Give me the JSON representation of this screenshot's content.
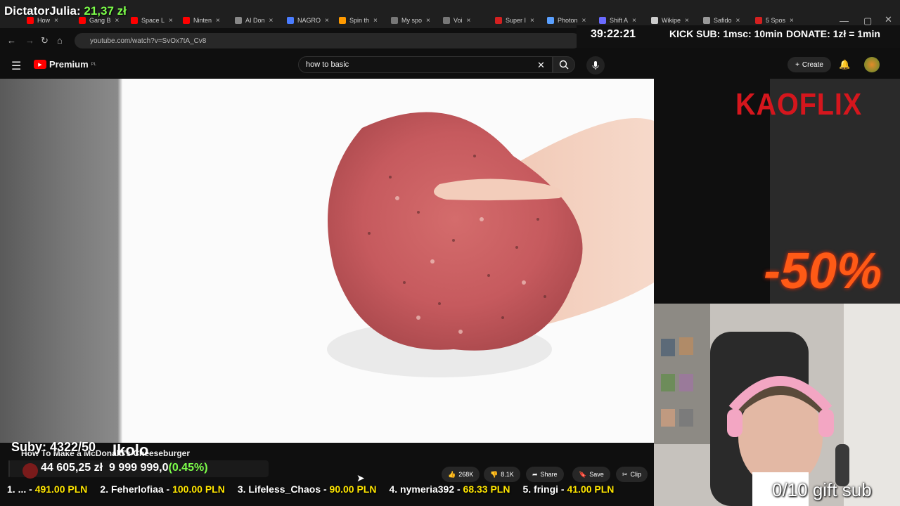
{
  "browser": {
    "tabs": [
      {
        "label": "How",
        "color": "#ff0000"
      },
      {
        "label": "Gang B",
        "color": "#ff0000"
      },
      {
        "label": "Space L",
        "color": "#ff0000"
      },
      {
        "label": "Ninten",
        "color": "#ff0000"
      },
      {
        "label": "AI Don",
        "color": "#888888"
      },
      {
        "label": "NAGRO",
        "color": "#4a7cff"
      },
      {
        "label": "Spin th",
        "color": "#ff9a00"
      },
      {
        "label": "My spo",
        "color": "#777777"
      },
      {
        "label": "Voi",
        "color": "#777777"
      },
      {
        "label": "Super I",
        "color": "#d42020"
      },
      {
        "label": "Photon",
        "color": "#5aa0ff"
      },
      {
        "label": "Shift A",
        "color": "#6a6aff"
      },
      {
        "label": "Wikipe",
        "color": "#cccccc"
      },
      {
        "label": "Safido",
        "color": "#999999"
      },
      {
        "label": "5 Spos",
        "color": "#d42020"
      }
    ],
    "url": "youtube.com/watch?v=SvOx7tA_Cv8"
  },
  "overlay": {
    "donor_name": "DictatorJulia:",
    "donor_amount": "21,37 zł",
    "timer": "39:22:21",
    "kick_sub": "KICK SUB: 1msc: 10min",
    "donate": "DONATE: 1zł = 1min",
    "kaoflix": "KAOFLIX",
    "promo": "-50%",
    "subs_count": "Suby: 4322/50",
    "goal_current": "44 605,25 zł",
    "goal_target": "9 999 999,0",
    "goal_pct": "0.45%",
    "goal_fill": 0.0045,
    "gift_sub": "0/10 gift sub",
    "ticker": [
      {
        "name": "1. ... - ",
        "value": "491.00 PLN"
      },
      {
        "name": "2. Feherlofiaa - ",
        "value": "100.00 PLN"
      },
      {
        "name": "3. Lifeless_Chaos - ",
        "value": "90.00 PLN"
      },
      {
        "name": "4. nymeria392 - ",
        "value": "68.33 PLN"
      },
      {
        "name": "5. fringi - ",
        "value": "41.00 PLN"
      }
    ]
  },
  "youtube": {
    "logo": "Premium",
    "logo_sup": "PL",
    "search_value": "how to basic",
    "create_label": "Create",
    "video_title": "How To Make a McDonald's Cheeseburger",
    "likes": "268K",
    "dislikes": "8.1K",
    "share": "Share",
    "save": "Save",
    "clip": "Clip"
  }
}
